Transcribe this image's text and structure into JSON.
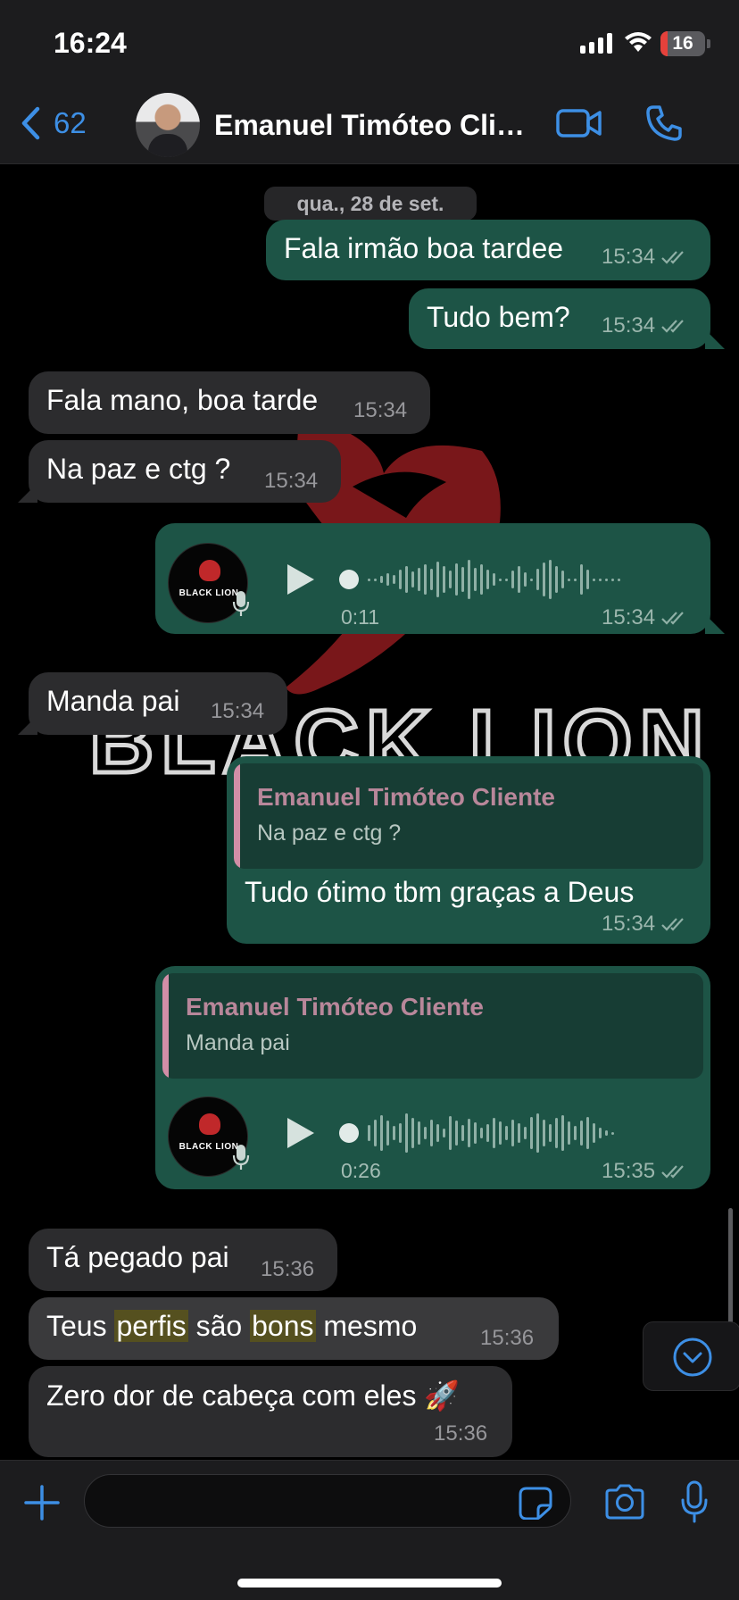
{
  "status_bar": {
    "time": "16:24",
    "battery": "16",
    "battery_level": 0.16
  },
  "header": {
    "back_count": "62",
    "contact_name": "Emanuel Timóteo Clie..."
  },
  "chat": {
    "date": "qua., 28 de set.",
    "messages": [
      {
        "direction": "out",
        "text": "Fala irmão boa tardee",
        "time": "15:34"
      },
      {
        "direction": "out",
        "text": "Tudo bem?",
        "time": "15:34"
      },
      {
        "direction": "in",
        "text": "Fala mano, boa tarde",
        "time": "15:34"
      },
      {
        "direction": "in",
        "text": "Na paz e ctg ?",
        "time": "15:34"
      },
      {
        "direction": "out",
        "type": "voice",
        "duration": "0:11",
        "time": "15:34",
        "brand": "BLACK LION"
      },
      {
        "direction": "in",
        "text": "Manda pai",
        "time": "15:34"
      },
      {
        "direction": "out",
        "quote_name": "Emanuel Timóteo Cliente",
        "quote_text": "Na paz e ctg ?",
        "text": "Tudo ótimo tbm graças a Deus",
        "time": "15:34"
      },
      {
        "direction": "out",
        "type": "voice",
        "quote_name": "Emanuel Timóteo Cliente",
        "quote_text": "Manda pai",
        "duration": "0:26",
        "time": "15:35",
        "brand": "BLACK LION"
      },
      {
        "direction": "in",
        "text": "Tá pegado pai",
        "time": "15:36"
      },
      {
        "direction": "in",
        "text_parts": [
          "Teus ",
          "perfis",
          " são ",
          "bons",
          " mesmo"
        ],
        "time": "15:36"
      },
      {
        "direction": "in",
        "text": "Zero dor de cabeça com eles 🚀",
        "time": "15:36"
      }
    ]
  },
  "input": {
    "placeholder": ""
  },
  "colors": {
    "outgoing_bubble": "#1d5446",
    "incoming_bubble": "#2c2c2e",
    "accent": "#3d8fe5",
    "highlight": "#55501f"
  },
  "icons": [
    "chevron-left-icon",
    "video-camera-icon",
    "phone-icon",
    "play-icon",
    "microphone-icon",
    "double-check-icon",
    "chevron-down-icon",
    "plus-icon",
    "sticker-icon",
    "camera-icon"
  ]
}
